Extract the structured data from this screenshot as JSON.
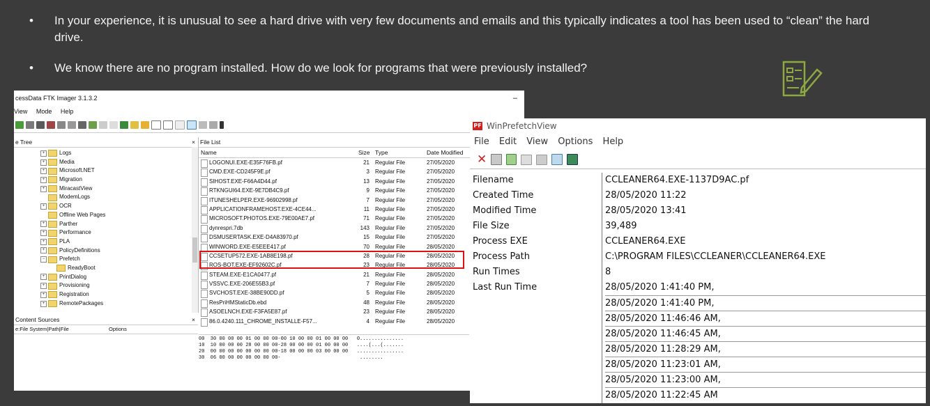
{
  "slide": {
    "bullets": [
      {
        "dot": "•",
        "text": "In your experience, it is unusual to see a hard drive with very few documents and emails and this typically indicates a tool has been used to “clean” the hard drive."
      },
      {
        "dot": "•",
        "text": "We know there are no program installed. How do we look for programs that were previously installed?"
      }
    ],
    "deco_icon": "document-pencil-icon",
    "accent_color": "#8ea842"
  },
  "ftk": {
    "title": "cessData FTK Imager 3.1.3.2",
    "minimize": "–",
    "menu": [
      "View",
      "Mode",
      "Help"
    ],
    "tree_header": "e Tree",
    "tree_items": [
      {
        "label": "Logs",
        "expander": "+"
      },
      {
        "label": "Media",
        "expander": "+"
      },
      {
        "label": "Microsoft.NET",
        "expander": "+"
      },
      {
        "label": "Migration",
        "expander": "+"
      },
      {
        "label": "MiracastView",
        "expander": "+"
      },
      {
        "label": "ModemLogs",
        "expander": ""
      },
      {
        "label": "OCR",
        "expander": "+"
      },
      {
        "label": "Offline Web Pages",
        "expander": ""
      },
      {
        "label": "Parther",
        "expander": "+"
      },
      {
        "label": "Performance",
        "expander": "+"
      },
      {
        "label": "PLA",
        "expander": "+"
      },
      {
        "label": "PolicyDefinitions",
        "expander": "+"
      },
      {
        "label": "Prefetch",
        "expander": "−"
      },
      {
        "label": "ReadyBoot",
        "expander": "",
        "indent": true
      },
      {
        "label": "PrintDialog",
        "expander": "+"
      },
      {
        "label": "Provisioning",
        "expander": "+"
      },
      {
        "label": "Registration",
        "expander": "+"
      },
      {
        "label": "RemotePackages",
        "expander": "+"
      }
    ],
    "content_sources": {
      "header": "Content Sources",
      "col1": "e:File System|Path|File",
      "col2": "Options"
    },
    "file_list": {
      "header": "File List",
      "columns": {
        "name": "Name",
        "size": "Size",
        "type": "Type",
        "date": "Date Modified"
      },
      "rows": [
        {
          "name": "LOGONUI.EXE-E35F76FB.pf",
          "size": "21",
          "type": "Regular File",
          "date": "27/05/2020"
        },
        {
          "name": "CMD.EXE-CD245F9E.pf",
          "size": "3",
          "type": "Regular File",
          "date": "27/05/2020"
        },
        {
          "name": "SIHOST.EXE-F66A4D44.pf",
          "size": "13",
          "type": "Regular File",
          "date": "27/05/2020"
        },
        {
          "name": "RTKNGUI64.EXE-9E7DB4C9.pf",
          "size": "9",
          "type": "Regular File",
          "date": "27/05/2020"
        },
        {
          "name": "ITUNESHELPER.EXE-96902998.pf",
          "size": "7",
          "type": "Regular File",
          "date": "27/05/2020"
        },
        {
          "name": "APPLICATIONFRAMEHOST.EXE-4CE44...",
          "size": "11",
          "type": "Regular File",
          "date": "27/05/2020"
        },
        {
          "name": "MICROSOFT.PHOTOS.EXE-79E00AE7.pf",
          "size": "71",
          "type": "Regular File",
          "date": "27/05/2020"
        },
        {
          "name": "dynrespri.7db",
          "size": "143",
          "type": "Regular File",
          "date": "27/05/2020"
        },
        {
          "name": "DSMUSERTASK.EXE-D4A83970.pf",
          "size": "15",
          "type": "Regular File",
          "date": "27/05/2020"
        },
        {
          "name": "WINWORD.EXE-E5EEE417.pf",
          "size": "70",
          "type": "Regular File",
          "date": "28/05/2020"
        },
        {
          "name": "CCSETUP572.EXE-1AB8E198.pf",
          "size": "28",
          "type": "Regular File",
          "date": "28/05/2020"
        },
        {
          "name": "ROS-BOT.EXE-EF92602C.pf",
          "size": "23",
          "type": "Regular File",
          "date": "28/05/2020"
        },
        {
          "name": "STEAM.EXE-E1CA0477.pf",
          "size": "21",
          "type": "Regular File",
          "date": "28/05/2020"
        },
        {
          "name": "VSSVC.EXE-206E55B3.pf",
          "size": "7",
          "type": "Regular File",
          "date": "28/05/2020"
        },
        {
          "name": "SVCHOST.EXE-38BE90DD.pf",
          "size": "5",
          "type": "Regular File",
          "date": "28/05/2020"
        },
        {
          "name": "ResPriHMStaticDb.ebd",
          "size": "48",
          "type": "Regular File",
          "date": "28/05/2020"
        },
        {
          "name": "ASOELNCH.EXE-F3FA5E87.pf",
          "size": "23",
          "type": "Regular File",
          "date": "28/05/2020"
        },
        {
          "name": "86.0.4240.111_CHROME_INSTALLE-F57...",
          "size": "4",
          "type": "Regular File",
          "date": "28/05/2020"
        }
      ]
    },
    "hex_lines": [
      "00  30 00 00 00 01 00 00 00-00 10 00 00 01 00 00 00   0...............",
      "10  10 00 00 00 28 00 00 00-28 00 00 00 01 00 00 00   ....(...(.......",
      "20  00 00 00 00 00 00 00 00-18 00 00 00 03 00 00 00   ................",
      "30  06 00 00 00 00 00 00 00-                           ........"
    ]
  },
  "wpv": {
    "title": "WinPrefetchView",
    "badge": "PF",
    "menu": [
      "File",
      "Edit",
      "View",
      "Options",
      "Help"
    ],
    "properties": [
      {
        "key": "Filename",
        "value": "CCLEANER64.EXE-1137D9AC.pf"
      },
      {
        "key": "Created Time",
        "value": "28/05/2020 11:22"
      },
      {
        "key": "Modified Time",
        "value": "28/05/2020 13:41"
      },
      {
        "key": "File Size",
        "value": "39,489"
      },
      {
        "key": "Process EXE",
        "value": "CCLEANER64.EXE"
      },
      {
        "key": "Process Path",
        "value": "C:\\PROGRAM FILES\\CCLEANER\\CCLEANER64.EXE"
      },
      {
        "key": "Run Times",
        "value": "8"
      },
      {
        "key": "Last Run Time",
        "value": "28/05/2020 1:41:40 PM,"
      }
    ],
    "last_run_more": [
      "28/05/2020 1:41:40 PM,",
      "28/05/2020 11:46:46 AM,",
      "28/05/2020 11:46:45 AM,",
      "28/05/2020 11:28:29 AM,",
      "28/05/2020 11:23:01 AM,",
      "28/05/2020 11:23:00 AM,",
      "28/05/2020 11:22:45 AM"
    ]
  }
}
